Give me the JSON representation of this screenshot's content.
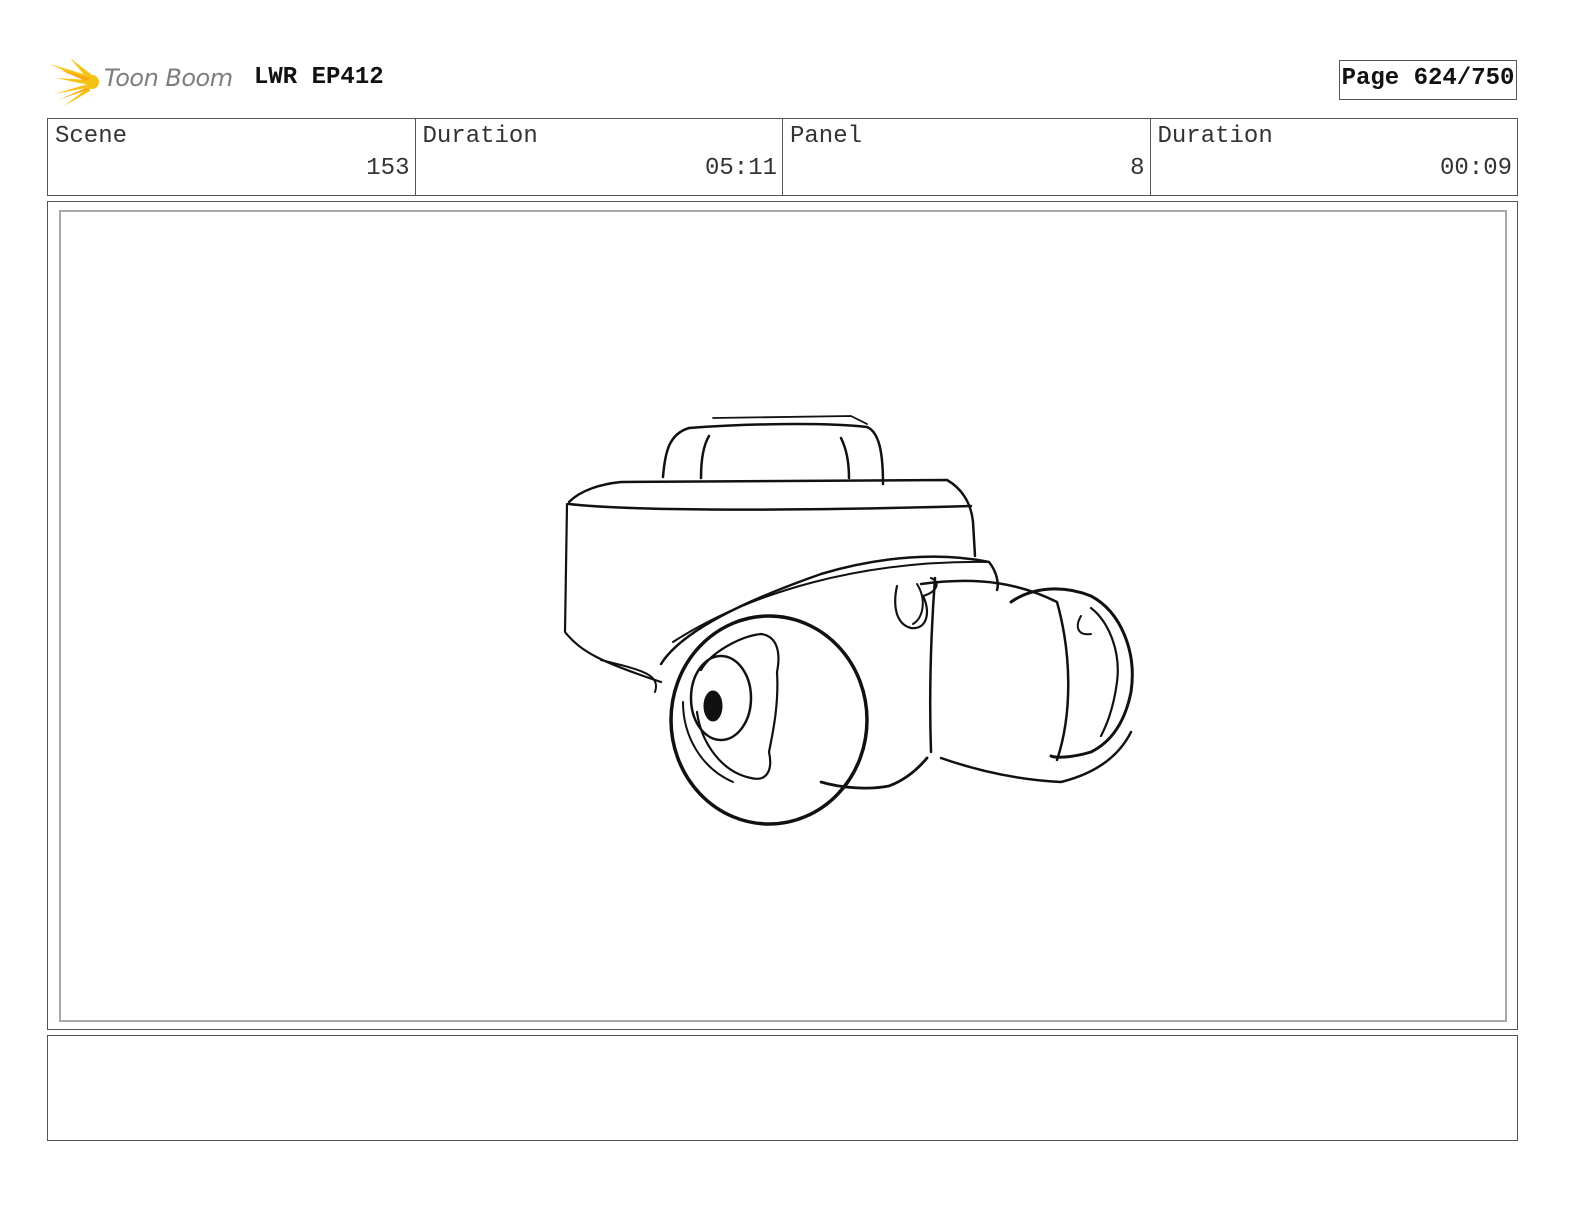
{
  "header": {
    "logo_text": "Toon Boom",
    "project_title": "LWR EP412",
    "page_indicator": "Page 624/750",
    "logo_color": "#f5c316"
  },
  "info": {
    "scene": {
      "label": "Scene",
      "value": "153"
    },
    "scene_duration": {
      "label": "Duration",
      "value": "05:11"
    },
    "panel": {
      "label": "Panel",
      "value": "8"
    },
    "panel_duration": {
      "label": "Duration",
      "value": "00:09"
    }
  },
  "panel_sketch": {
    "subject": "sketch of a helmet-mounted camera",
    "line_color": "#111111"
  },
  "notes": {
    "text": ""
  }
}
